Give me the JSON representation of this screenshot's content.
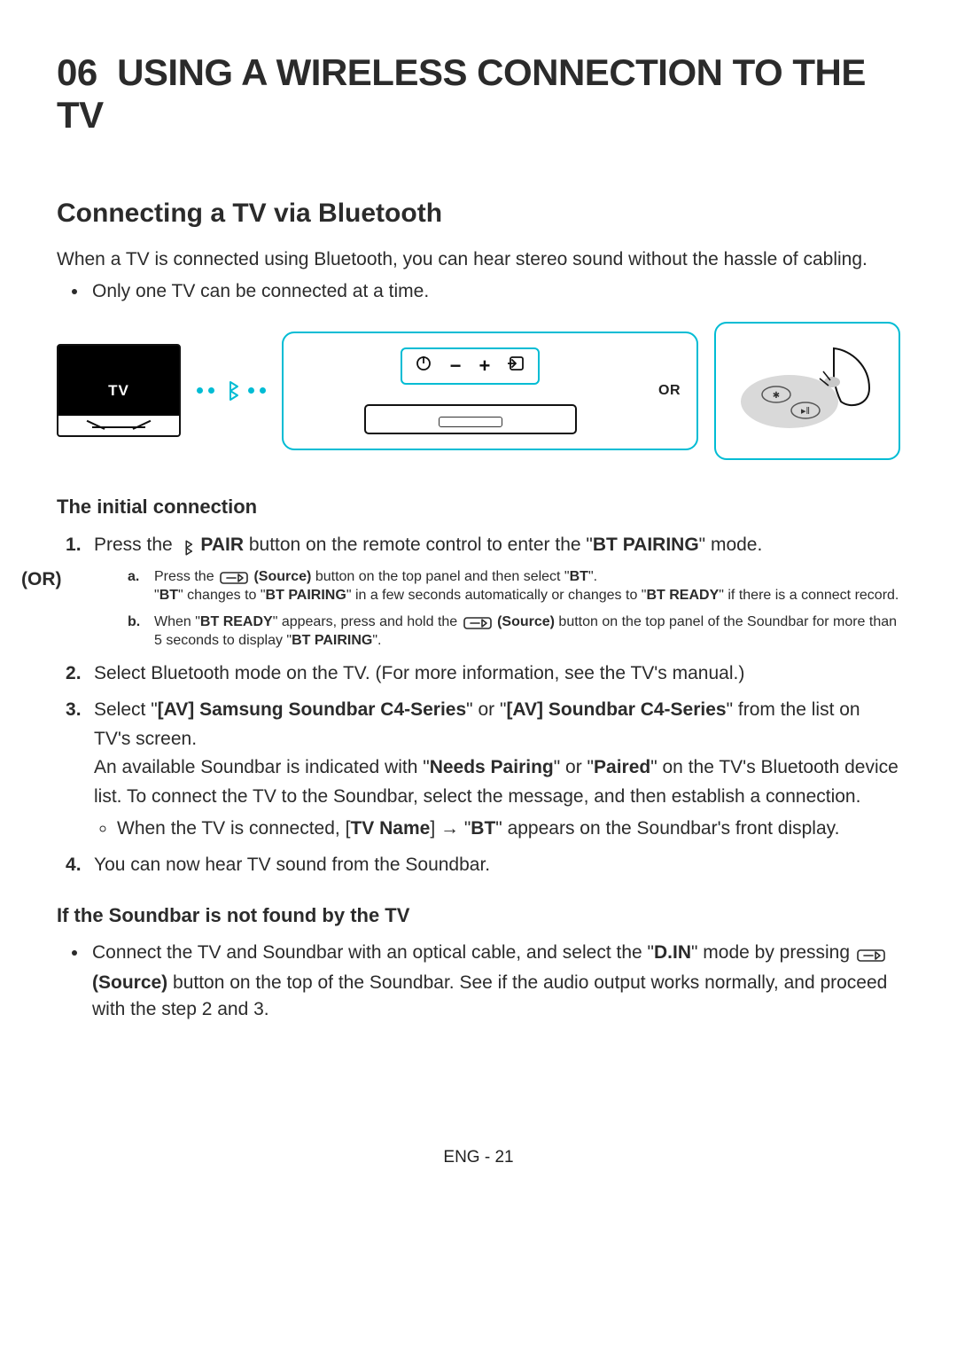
{
  "chapter": {
    "num": "06",
    "title": "USING A WIRELESS CONNECTION TO THE TV"
  },
  "section_title": "Connecting a TV via Bluetooth",
  "intro": "When a TV is connected using Bluetooth, you can hear stereo sound without the hassle of cabling.",
  "note_bullet": "Only one TV can be connected at a time.",
  "diagram": {
    "tv_label": "TV",
    "or_label": "OR"
  },
  "sub1_title": "The initial connection",
  "step1": {
    "pre": "Press the ",
    "pair_label": " PAIR",
    "mid": " button on the remote control to enter the \"",
    "mode": "BT PAIRING",
    "post": "\" mode."
  },
  "or_label": "(OR)",
  "step_a": {
    "pre": "Press the ",
    "src_label": " (Source)",
    "mid": " button on the top panel and then select \"",
    "bt": "BT",
    "post": "\".",
    "line2_pre": "\"",
    "line2_bt": "BT",
    "line2_mid1": "\" changes to \"",
    "line2_pair": "BT PAIRING",
    "line2_mid2": "\" in a few seconds automatically or changes to \"",
    "line2_ready": "BT READY",
    "line2_post": "\" if there is a connect record."
  },
  "step_b": {
    "pre": "When \"",
    "ready": "BT READY",
    "mid1": "\" appears, press and hold the ",
    "src_label": " (Source)",
    "mid2": " button on the top panel of the Soundbar for more than 5 seconds to display \"",
    "pair": "BT PAIRING",
    "post": "\"."
  },
  "step2": "Select Bluetooth mode on the TV. (For more information, see the TV's manual.)",
  "step3": {
    "pre": "Select \"",
    "dev1": "[AV] Samsung Soundbar C4-Series",
    "mid1": "\" or \"",
    "dev2": "[AV] Soundbar C4-Series",
    "post1": "\" from the list on TV's screen.",
    "line2_pre": "An available Soundbar is indicated with \"",
    "needs": "Needs Pairing",
    "line2_mid": "\" or \"",
    "paired": "Paired",
    "line2_post": "\" on the TV's Bluetooth device list. To connect the TV to the Soundbar, select the message, and then establish a connection.",
    "bullet_pre": "When the TV is connected, [",
    "tvname": "TV Name",
    "bullet_mid": "] → \"",
    "bt": "BT",
    "bullet_post": "\" appears on the Soundbar's front display."
  },
  "step4": "You can now hear TV sound from the Soundbar.",
  "sub2_title": "If the Soundbar is not found by the TV",
  "sub2_bullet": {
    "pre": "Connect the TV and Soundbar with an optical cable, and select the \"",
    "din": "D.IN",
    "mid1": "\" mode by pressing ",
    "src_label": " (Source)",
    "post": " button on the top of the Soundbar. See if the audio output works normally, and proceed with the step 2 and 3."
  },
  "footer": "ENG - 21"
}
